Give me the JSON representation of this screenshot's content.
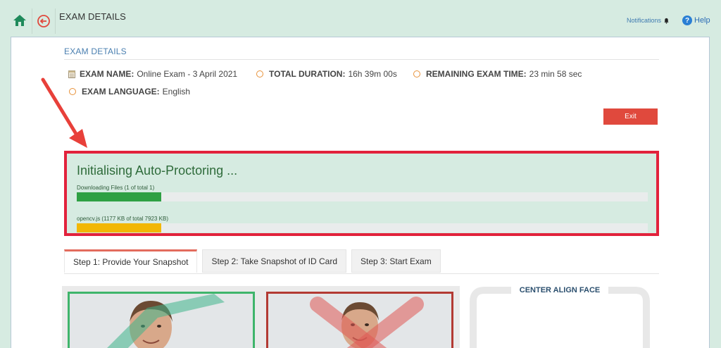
{
  "header": {
    "title": "EXAM DETAILS",
    "notifications_label": "Notifications",
    "help_label": "Help"
  },
  "exam": {
    "section_title": "EXAM DETAILS",
    "name_label": "EXAM NAME:",
    "name_value": "Online Exam - 3 April 2021",
    "duration_label": "TOTAL DURATION:",
    "duration_value": "16h 39m 00s",
    "remaining_label": "REMAINING EXAM TIME:",
    "remaining_value": "23 min 58 sec",
    "language_label": "EXAM LANGUAGE:",
    "language_value": "English",
    "exit_label": "Exit"
  },
  "proctoring": {
    "title": "Initialising Auto-Proctoring ...",
    "files_label": "Downloading Files (1 of total 1)",
    "files_progress": 0.148,
    "file_label": "opencv.js (1177 KB of total 7923 KB)",
    "file_progress": 0.148
  },
  "tabs": [
    {
      "label": "Step 1: Provide Your Snapshot"
    },
    {
      "label": "Step 2: Take Snapshot of ID Card"
    },
    {
      "label": "Step 3: Start Exam"
    }
  ],
  "snapshot": {
    "align_title": "CENTER ALIGN FACE"
  },
  "colors": {
    "accent": "#e2223c",
    "progress_green": "#2ea043",
    "progress_yellow": "#f2b705",
    "exit_red": "#e0493d"
  }
}
